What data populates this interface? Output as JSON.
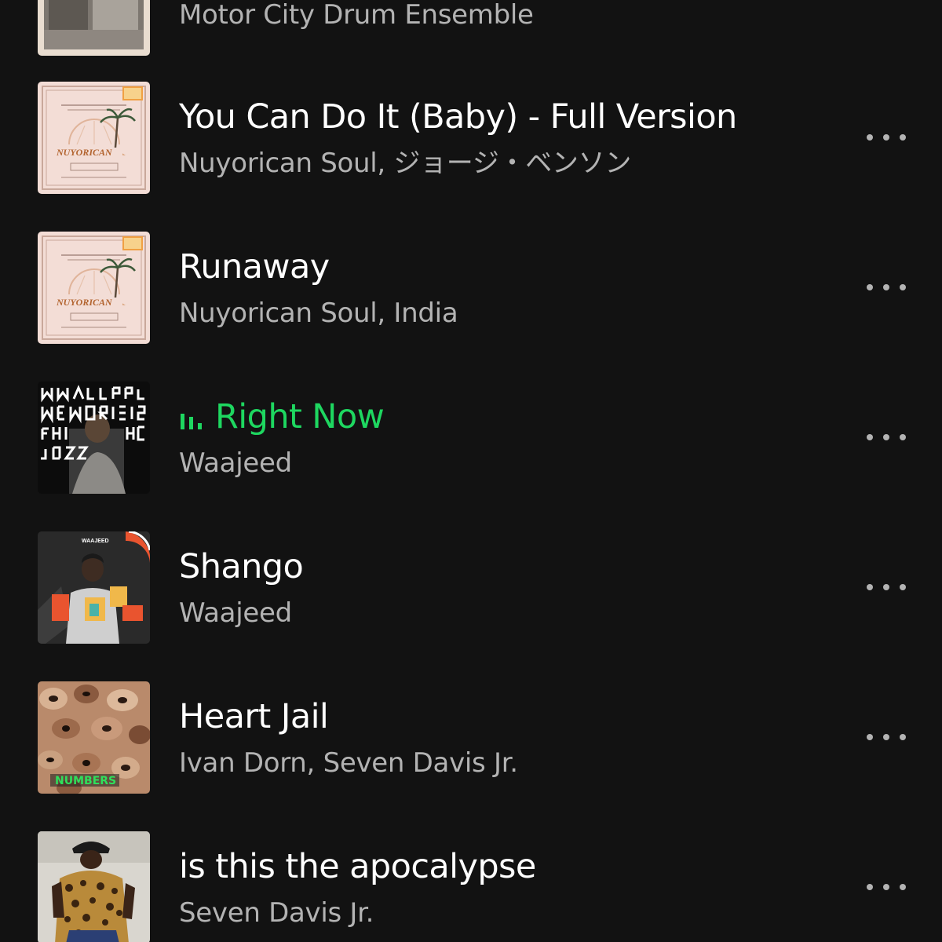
{
  "tracks": [
    {
      "title": "",
      "subtitle": "Motor City Drum Ensemble",
      "cover_icon": "motor-city-album-cover",
      "playing": false
    },
    {
      "title": "You Can Do It (Baby) - Full Version",
      "subtitle": "Nuyorican Soul, ジョージ・ベンソン",
      "cover_icon": "nuyorican-soul-album-cover",
      "playing": false
    },
    {
      "title": "Runaway",
      "subtitle": "Nuyorican Soul, India",
      "cover_icon": "nuyorican-soul-album-cover",
      "playing": false
    },
    {
      "title": "Right Now",
      "subtitle": "Waajeed",
      "cover_icon": "waajeed-memoirs-album-cover",
      "playing": true
    },
    {
      "title": "Shango",
      "subtitle": "Waajeed",
      "cover_icon": "waajeed-shango-album-cover",
      "playing": false
    },
    {
      "title": "Heart Jail",
      "subtitle": "Ivan Dorn, Seven Davis Jr.",
      "cover_icon": "numbers-album-cover",
      "playing": false
    },
    {
      "title": "is this the apocalypse",
      "subtitle": "Seven Davis Jr.",
      "cover_icon": "seven-davis-album-cover",
      "playing": false
    }
  ],
  "cover_text": {
    "nuyorican_logo": "NUYORICAN",
    "numbers_logo": "NUMBERS",
    "waajeed_label": "WAAJEED"
  },
  "colors": {
    "background": "#121212",
    "title": "#ffffff",
    "subtitle": "#b3b3b3",
    "accent_playing": "#1ed760"
  }
}
